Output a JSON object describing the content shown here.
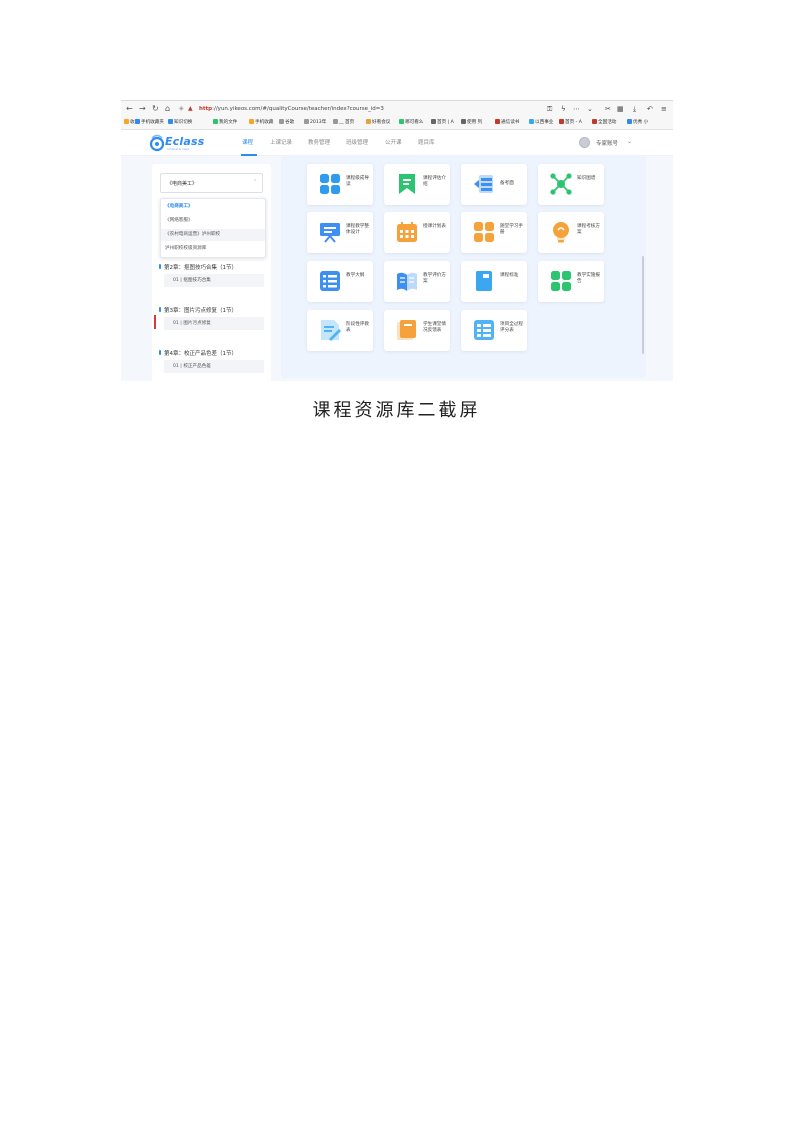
{
  "browser": {
    "url_scheme": "http",
    "url_rest": "://yun.yikeos.com/#/qualityCourse/teacher/index?course_id=3",
    "bookmarks": [
      "收藏",
      "手机收藏夹",
      "知识切换",
      "我的文件",
      "手机收藏",
      "谷歌",
      "2013年",
      "__ 首页",
      "好看会议",
      "哪可看么",
      "首页 | A",
      "使用 列",
      "通信读书",
      "以西事业",
      "首页 - A",
      "全国活动",
      "优秀 小"
    ]
  },
  "app": {
    "logo_text": "Eclass",
    "logo_sub": "Intranet & class",
    "nav_tabs": [
      "课程",
      "上课记录",
      "教务管理",
      "班级管理",
      "公开课",
      "题目库"
    ],
    "active_tab": 0,
    "user_name": "专家账号"
  },
  "sidebar": {
    "course_select_value": "《电商美工》",
    "dropdown": [
      "《电商美工》",
      "《网络客服》",
      "《农村电商运营》泸州职校",
      "泸州职校校级资源库"
    ],
    "chapters": [
      {
        "title": "第2章：抠图技巧合集（1节）",
        "lesson": "01 | 抠图技巧合集"
      },
      {
        "title": "第3章：图片污点修复（1节）",
        "lesson": "01 | 图片污点修复"
      },
      {
        "title": "第4章：校正产品色差（1节）",
        "lesson": "01 | 校正产品色差"
      }
    ]
  },
  "resources": [
    {
      "label": "课程级 成导读",
      "icon": "four-squares-icon",
      "color": "#2f9bf0"
    },
    {
      "label": "课程评 估介绍",
      "icon": "bookmark-icon",
      "color": "#2bc46f"
    },
    {
      "label": "备考面",
      "icon": "list-arrow-icon",
      "color": "#3d8ff2"
    },
    {
      "label": "知识图 谱",
      "icon": "network-icon",
      "color": "#2bc46f"
    },
    {
      "label": "课程教 学整体 设计",
      "icon": "presentation-icon",
      "color": "#3d8ff2"
    },
    {
      "label": "授课计 划表",
      "icon": "calendar-icon",
      "color": "#f5a23a"
    },
    {
      "label": "随堂学 习手册",
      "icon": "four-squares-icon",
      "color": "#f5a23a"
    },
    {
      "label": "课程考 核方案",
      "icon": "bulb-icon",
      "color": "#f5a23a"
    },
    {
      "label": "教学大 纲",
      "icon": "list-icon",
      "color": "#3d8ff2"
    },
    {
      "label": "教学评 价方案",
      "icon": "open-book-icon",
      "color": "#3d8ff2"
    },
    {
      "label": "课程标 准",
      "icon": "book-icon",
      "color": "#3aa7f0"
    },
    {
      "label": "教学实 施报告",
      "icon": "four-squares-icon",
      "color": "#2bc46f"
    },
    {
      "label": "阶段性 评教表",
      "icon": "document-edit-icon",
      "color": "#4fb3f5"
    },
    {
      "label": "学生课 堂情况 反馈表",
      "icon": "books-icon",
      "color": "#f5a23a"
    },
    {
      "label": "项目全 过程评 分表",
      "icon": "table-icon",
      "color": "#4fb3f5"
    }
  ],
  "caption": "课程资源库二截屏"
}
